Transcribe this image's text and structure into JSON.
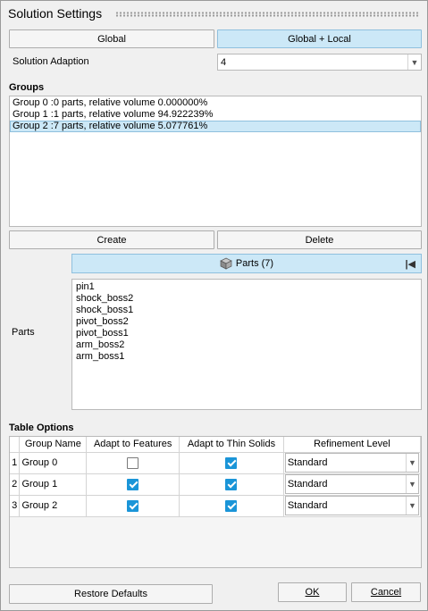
{
  "window": {
    "title": "Solution Settings"
  },
  "mode_tabs": {
    "global": "Global",
    "global_local": "Global + Local",
    "selected": "global_local"
  },
  "solution_adaption": {
    "label": "Solution Adaption",
    "value": "4"
  },
  "groups": {
    "label": "Groups",
    "items": [
      "Group 0 :0 parts, relative volume 0.000000%",
      "Group 1 :1 parts, relative volume 94.922239%",
      "Group 2 :7 parts, relative volume 5.077761%"
    ],
    "selected_index": 2,
    "create_label": "Create",
    "delete_label": "Delete"
  },
  "parts": {
    "label": "Parts",
    "header": "Parts (7)",
    "header_icon": "cube-icon",
    "collapse_icon": "collapse-icon",
    "items": [
      "pin1",
      "shock_boss2",
      "shock_boss1",
      "pivot_boss2",
      "pivot_boss1",
      "arm_boss2",
      "arm_boss1"
    ]
  },
  "table_options": {
    "label": "Table Options",
    "columns": [
      "Group Name",
      "Adapt to Features",
      "Adapt to Thin Solids",
      "Refinement Level"
    ],
    "rows": [
      {
        "num": "1",
        "name": "Group 0",
        "adapt_features": false,
        "adapt_thin": true,
        "refinement": "Standard"
      },
      {
        "num": "2",
        "name": "Group 1",
        "adapt_features": true,
        "adapt_thin": true,
        "refinement": "Standard"
      },
      {
        "num": "3",
        "name": "Group 2",
        "adapt_features": true,
        "adapt_thin": true,
        "refinement": "Standard"
      }
    ]
  },
  "footer": {
    "restore_label": "Restore Defaults",
    "ok_label": "OK",
    "cancel_label": "Cancel"
  },
  "colors": {
    "selected_bg": "#cce8f7",
    "check_on": "#1a95d8"
  }
}
